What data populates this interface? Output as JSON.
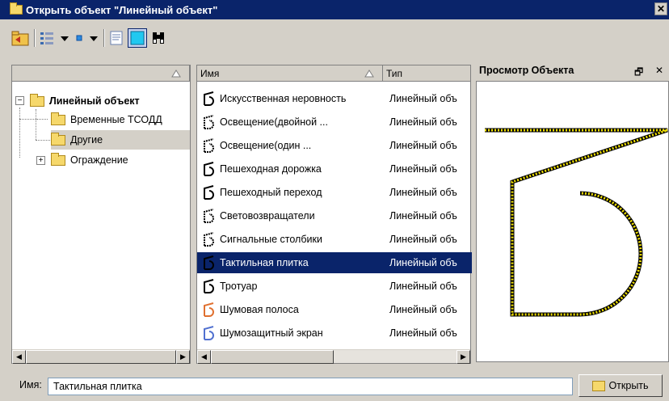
{
  "window": {
    "title": "Открыть объект \"Линейный объект\"",
    "close_glyph": "✕"
  },
  "toolbar": {
    "icons": [
      "folder-up-icon",
      "view-list-icon",
      "dropdown-arrow-icon",
      "small-icon-view-icon",
      "dropdown-arrow-icon",
      "details-view-icon",
      "preview-toggle-icon",
      "binoculars-icon"
    ]
  },
  "tree": {
    "items": [
      {
        "label": "Линейный объект",
        "expander": "−"
      },
      {
        "label": "Временные ТСОДД"
      },
      {
        "label": "Другие"
      },
      {
        "label": "Ограждение",
        "expander": "+"
      }
    ]
  },
  "list": {
    "columns": {
      "name": "Имя",
      "type": "Тип"
    },
    "rows": [
      {
        "name": "Искусственная неровность",
        "type": "Линейный объ"
      },
      {
        "name": "Освещение(двойной ...",
        "type": "Линейный объ"
      },
      {
        "name": "Освещение(один ...",
        "type": "Линейный объ"
      },
      {
        "name": "Пешеходная дорожка",
        "type": "Линейный объ"
      },
      {
        "name": "Пешеходный переход",
        "type": "Линейный объ"
      },
      {
        "name": "Световозвращатели",
        "type": "Линейный объ"
      },
      {
        "name": "Сигнальные столбики",
        "type": "Линейный объ"
      },
      {
        "name": "Тактильная плитка",
        "type": "Линейный объ"
      },
      {
        "name": "Тротуар",
        "type": "Линейный объ"
      },
      {
        "name": "Шумовая полоса",
        "type": "Линейный объ"
      },
      {
        "name": "Шумозащитный экран",
        "type": "Линейный объ"
      }
    ],
    "selected_index": 7
  },
  "preview": {
    "title": "Просмотр Объекта",
    "restore_glyph": "🗗",
    "close_glyph": "✕"
  },
  "footer": {
    "name_label": "Имя:",
    "name_value": "Тактильная плитка",
    "open_button": "Открыть"
  },
  "colors": {
    "titlebar": "#0a246a",
    "selection": "#0a246a",
    "window_bg": "#d4d0c8",
    "folder": "#f6d86b",
    "preview_stroke": "#f0e000"
  }
}
